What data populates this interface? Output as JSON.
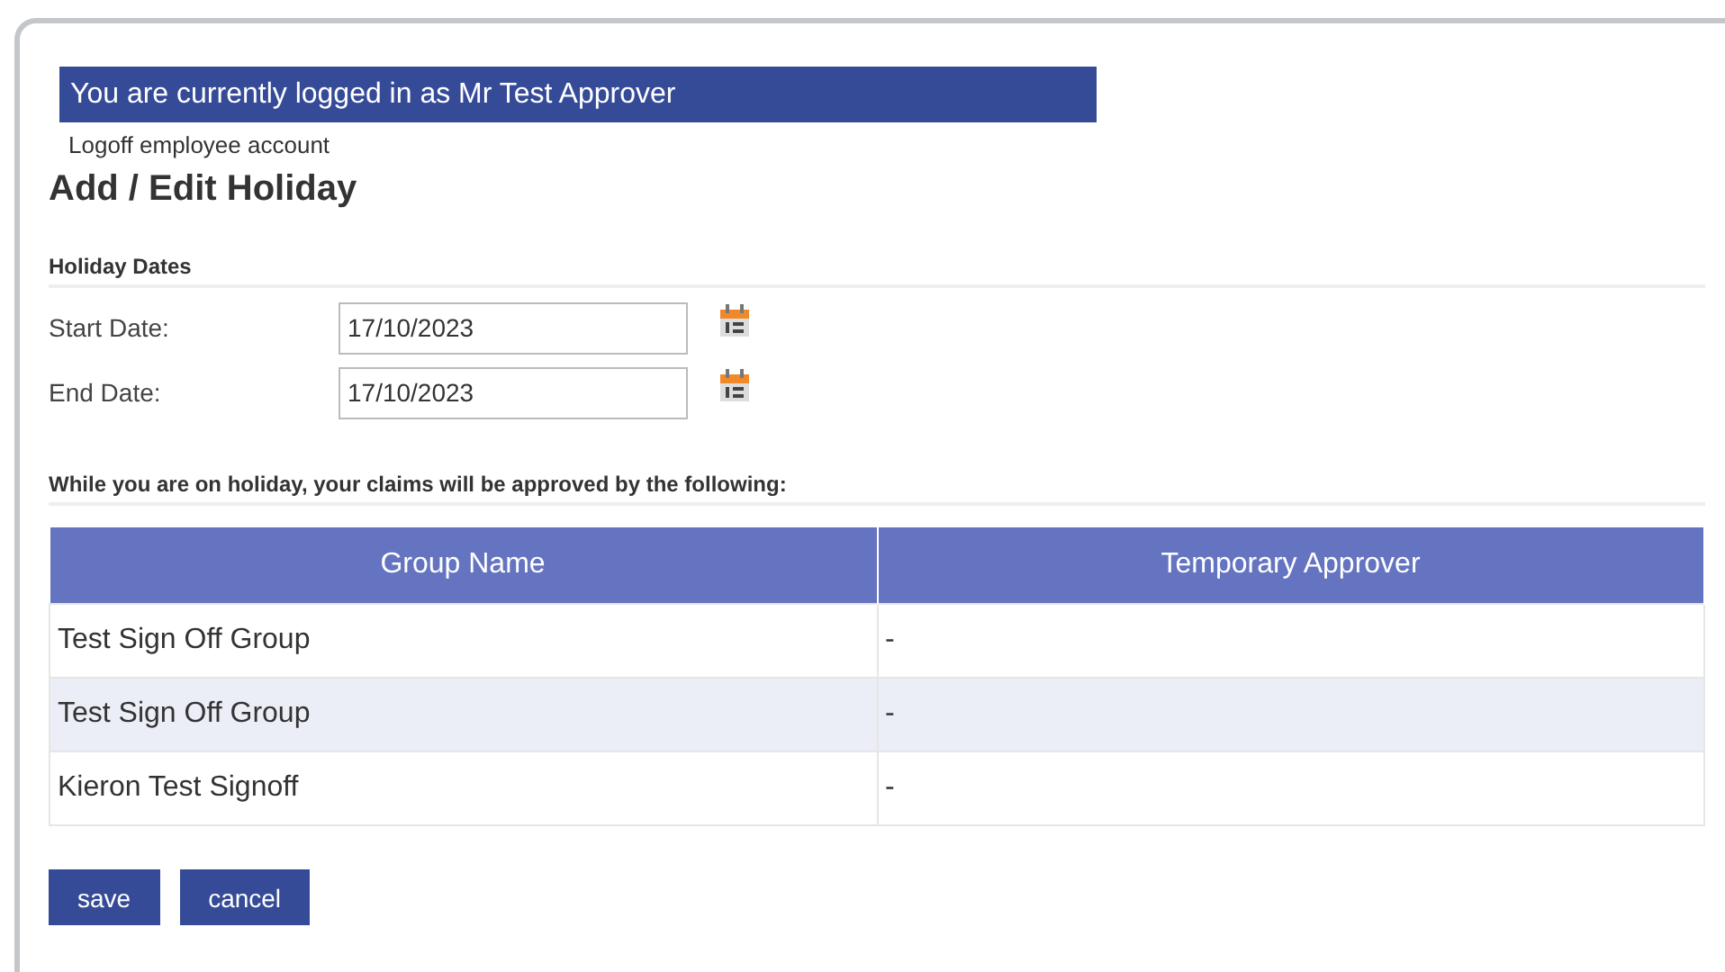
{
  "banner": "You are currently logged in as Mr Test Approver",
  "logoff_link": "Logoff employee account",
  "title": "Add / Edit Holiday",
  "dates_section": {
    "heading": "Holiday Dates",
    "fields": [
      {
        "label": "Start Date:",
        "value": "17/10/2023"
      },
      {
        "label": "End Date:",
        "value": "17/10/2023"
      }
    ]
  },
  "approvers_section": {
    "heading": "While you are on holiday, your claims will be approved by the following:",
    "table": {
      "columns": [
        "Group Name",
        "Temporary Approver"
      ],
      "rows": [
        [
          "Test Sign Off Group",
          "-"
        ],
        [
          "Test Sign Off Group",
          "-"
        ],
        [
          "Kieron Test Signoff",
          "-"
        ]
      ]
    }
  },
  "buttons": [
    "save",
    "cancel"
  ]
}
